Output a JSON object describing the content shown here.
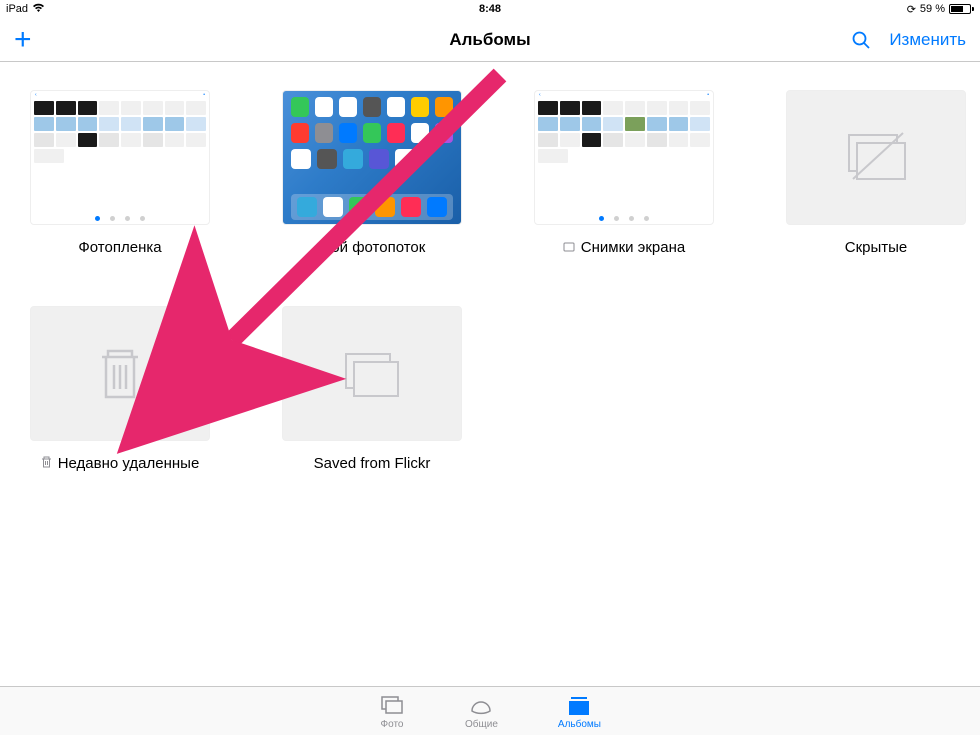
{
  "status_bar": {
    "carrier": "iPad",
    "time": "8:48",
    "battery_pct": "59 %"
  },
  "nav": {
    "title": "Альбомы",
    "edit": "Изменить"
  },
  "albums": [
    {
      "key": "camera-roll",
      "label": "Фотопленка",
      "thumb": "ipad-grid",
      "icon": null
    },
    {
      "key": "photostream",
      "label": "Мой фотопоток",
      "thumb": "ios-home",
      "icon": null
    },
    {
      "key": "screenshots",
      "label": "Снимки экрана",
      "thumb": "ipad-grid",
      "icon": "device"
    },
    {
      "key": "hidden",
      "label": "Скрытые",
      "thumb": "hidden",
      "icon": null
    },
    {
      "key": "recently-deleted",
      "label": "Недавно удаленные",
      "thumb": "trash",
      "icon": "trash"
    },
    {
      "key": "flickr",
      "label": "Saved from Flickr",
      "thumb": "stack",
      "icon": null
    }
  ],
  "tabs": {
    "photos": "Фото",
    "shared": "Общие",
    "albums": "Альбомы",
    "active": "albums"
  }
}
